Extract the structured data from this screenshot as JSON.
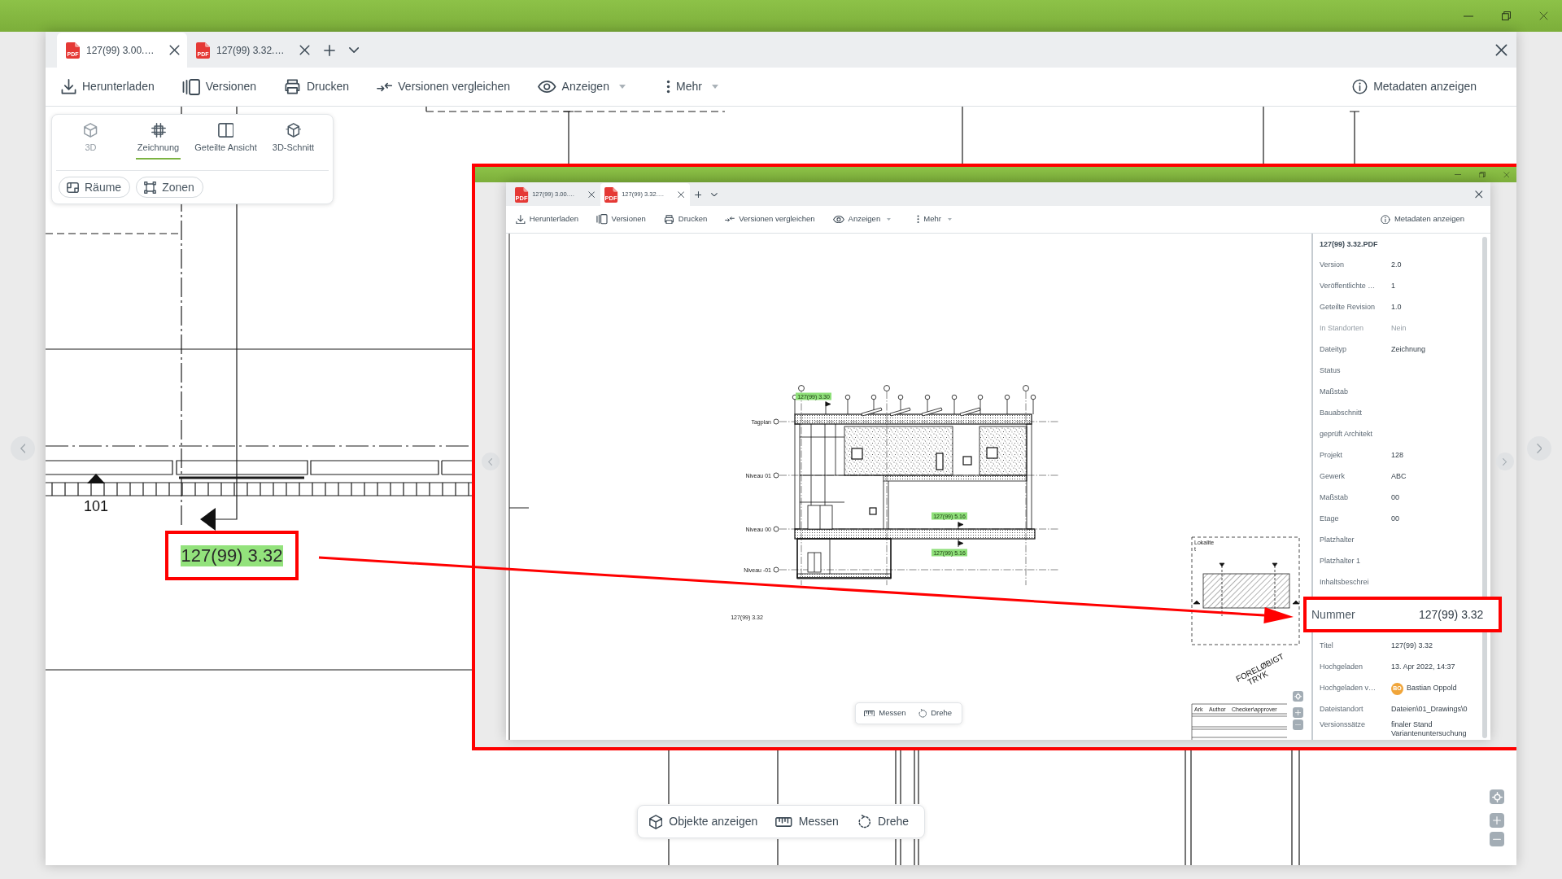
{
  "tabs": [
    {
      "file_type": "PDF",
      "label": "127(99) 3.00.…",
      "selected": true
    },
    {
      "file_type": "PDF",
      "label": "127(99) 3.32.…",
      "selected": false
    }
  ],
  "toolbar": {
    "actions": [
      {
        "label": "Herunterladen",
        "dropdown": false
      },
      {
        "label": "Versionen",
        "dropdown": false
      },
      {
        "label": "Drucken",
        "dropdown": false
      },
      {
        "label": "Versionen vergleichen",
        "dropdown": false
      },
      {
        "label": "Anzeigen",
        "dropdown": true
      },
      {
        "label": "Mehr",
        "dropdown": true
      }
    ],
    "metadata_toggle": {
      "label": "Metadaten anzeigen"
    }
  },
  "view_switcher": {
    "modes": [
      {
        "label": "3D",
        "selected": false,
        "disabled": true
      },
      {
        "label": "Zeichnung",
        "selected": true,
        "disabled": false
      },
      {
        "label": "Geteilte Ansicht",
        "selected": false,
        "disabled": false
      },
      {
        "label": "3D-Schnitt",
        "selected": false,
        "disabled": false
      }
    ],
    "filters": [
      {
        "label": "Räume"
      },
      {
        "label": "Zonen"
      }
    ]
  },
  "plan": {
    "marker_label": "101",
    "sheet_reference": "127(99) 3.32"
  },
  "bottom_toolbar": [
    {
      "label": "Objekte anzeigen"
    },
    {
      "label": "Messen"
    },
    {
      "label": "Drehe"
    }
  ],
  "inset": {
    "tabs": [
      {
        "file_type": "PDF",
        "label": "127(99) 3.00.…",
        "selected": false
      },
      {
        "file_type": "PDF",
        "label": "127(99) 3.32.…",
        "selected": true
      }
    ],
    "toolbar": {
      "actions": [
        {
          "label": "Herunterladen",
          "dropdown": false
        },
        {
          "label": "Versionen",
          "dropdown": false
        },
        {
          "label": "Drucken",
          "dropdown": false
        },
        {
          "label": "Versionen vergleichen",
          "dropdown": false
        },
        {
          "label": "Anzeigen",
          "dropdown": true
        },
        {
          "label": "Mehr",
          "dropdown": true
        }
      ],
      "metadata_toggle": {
        "label": "Metadaten anzeigen"
      }
    },
    "drawing": {
      "section_tags": [
        "127(99) 3.30",
        "127(99) 5.16",
        "127(99) 5.16"
      ],
      "level_labels": [
        "Tagplan",
        "Niveau 01",
        "Niveau 00",
        "Niveau -01"
      ],
      "sheet_reference": "127(99) 3.32",
      "key_plan_label": [
        "Lokalite",
        "t"
      ],
      "stamp": [
        "FORELØBIGT",
        "TRYK"
      ],
      "title_block_headers": [
        "Ark",
        "Author",
        "Checker\\approver"
      ]
    },
    "bottom_toolbar": [
      {
        "label": "Messen"
      },
      {
        "label": "Drehe"
      }
    ],
    "metadata": {
      "title": "127(99) 3.32.PDF",
      "rows": [
        {
          "kind": "text",
          "label": "Version",
          "value": "2.0",
          "disabled": false
        },
        {
          "kind": "text",
          "label": "Veröffentlichte …",
          "value": "1",
          "disabled": false
        },
        {
          "kind": "text",
          "label": "Geteilte Revision",
          "value": "1.0",
          "disabled": false
        },
        {
          "kind": "text",
          "label": "In Standorten",
          "value": "Nein",
          "disabled": true
        },
        {
          "kind": "text",
          "label": "Dateityp",
          "value": "Zeichnung",
          "disabled": false
        },
        {
          "kind": "text",
          "label": "Status",
          "disabled": false
        },
        {
          "kind": "text",
          "label": "Maßstab",
          "disabled": false
        },
        {
          "kind": "text",
          "label": "Bauabschnitt",
          "disabled": false
        },
        {
          "kind": "text",
          "label": "geprüft Architekt",
          "disabled": false
        },
        {
          "kind": "text",
          "label": "Projekt",
          "value": "128",
          "disabled": false
        },
        {
          "kind": "text",
          "label": "Gewerk",
          "value": "ABC",
          "disabled": false
        },
        {
          "kind": "text",
          "label": "Maßstab",
          "value": "00",
          "disabled": false
        },
        {
          "kind": "text",
          "label": "Etage",
          "value": "00",
          "disabled": false
        },
        {
          "kind": "text",
          "label": "Platzhalter",
          "disabled": false
        },
        {
          "kind": "text",
          "label": "Platzhalter 1",
          "disabled": false
        },
        {
          "kind": "text",
          "label": "Inhaltsbeschrei",
          "disabled": false
        },
        {
          "kind": "callout",
          "label": "Nummer",
          "value": "127(99) 3.32",
          "disabled": false
        },
        {
          "kind": "text",
          "label": "Titel",
          "value": "127(99) 3.32",
          "disabled": false
        },
        {
          "kind": "text",
          "label": "Hochgeladen",
          "value": "13. Apr 2022, 14:37",
          "disabled": false
        },
        {
          "kind": "user",
          "label": "Hochgeladen v…",
          "initials": "BO",
          "value": "Bastian Oppold",
          "disabled": false
        },
        {
          "kind": "text",
          "label": "Dateistandort",
          "value": "Dateien\\01_Drawings\\0",
          "disabled": false
        },
        {
          "kind": "list",
          "label": "Versionssätze",
          "values": [
            "finaler Stand",
            "Variantenuntersuchung"
          ],
          "disabled": false
        }
      ]
    }
  }
}
